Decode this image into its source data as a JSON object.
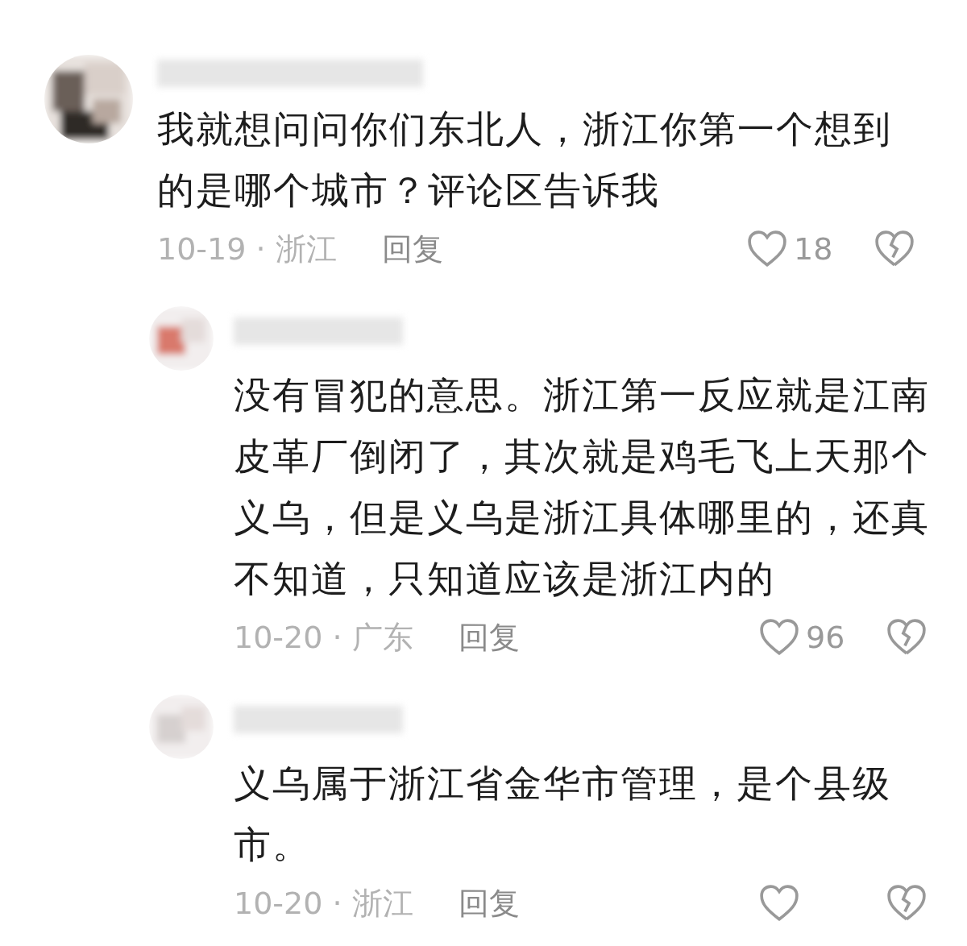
{
  "comments": [
    {
      "text": "我就想问问你们东北人，浙江你第一个想到的是哪个城市？评论区告诉我",
      "meta": "10-19 · 浙江",
      "reply_label": "回复",
      "likes": "18",
      "replies": [
        {
          "text": "没有冒犯的意思。浙江第一反应就是江南皮革厂倒闭了，其次就是鸡毛飞上天那个义乌，但是义乌是浙江具体哪里的，还真不知道，只知道应该是浙江内的",
          "meta": "10-20 · 广东",
          "reply_label": "回复",
          "likes": "96"
        },
        {
          "text": "义乌属于浙江省金华市管理，是个县级市。",
          "meta": "10-20 · 浙江",
          "reply_label": "回复"
        }
      ]
    }
  ]
}
